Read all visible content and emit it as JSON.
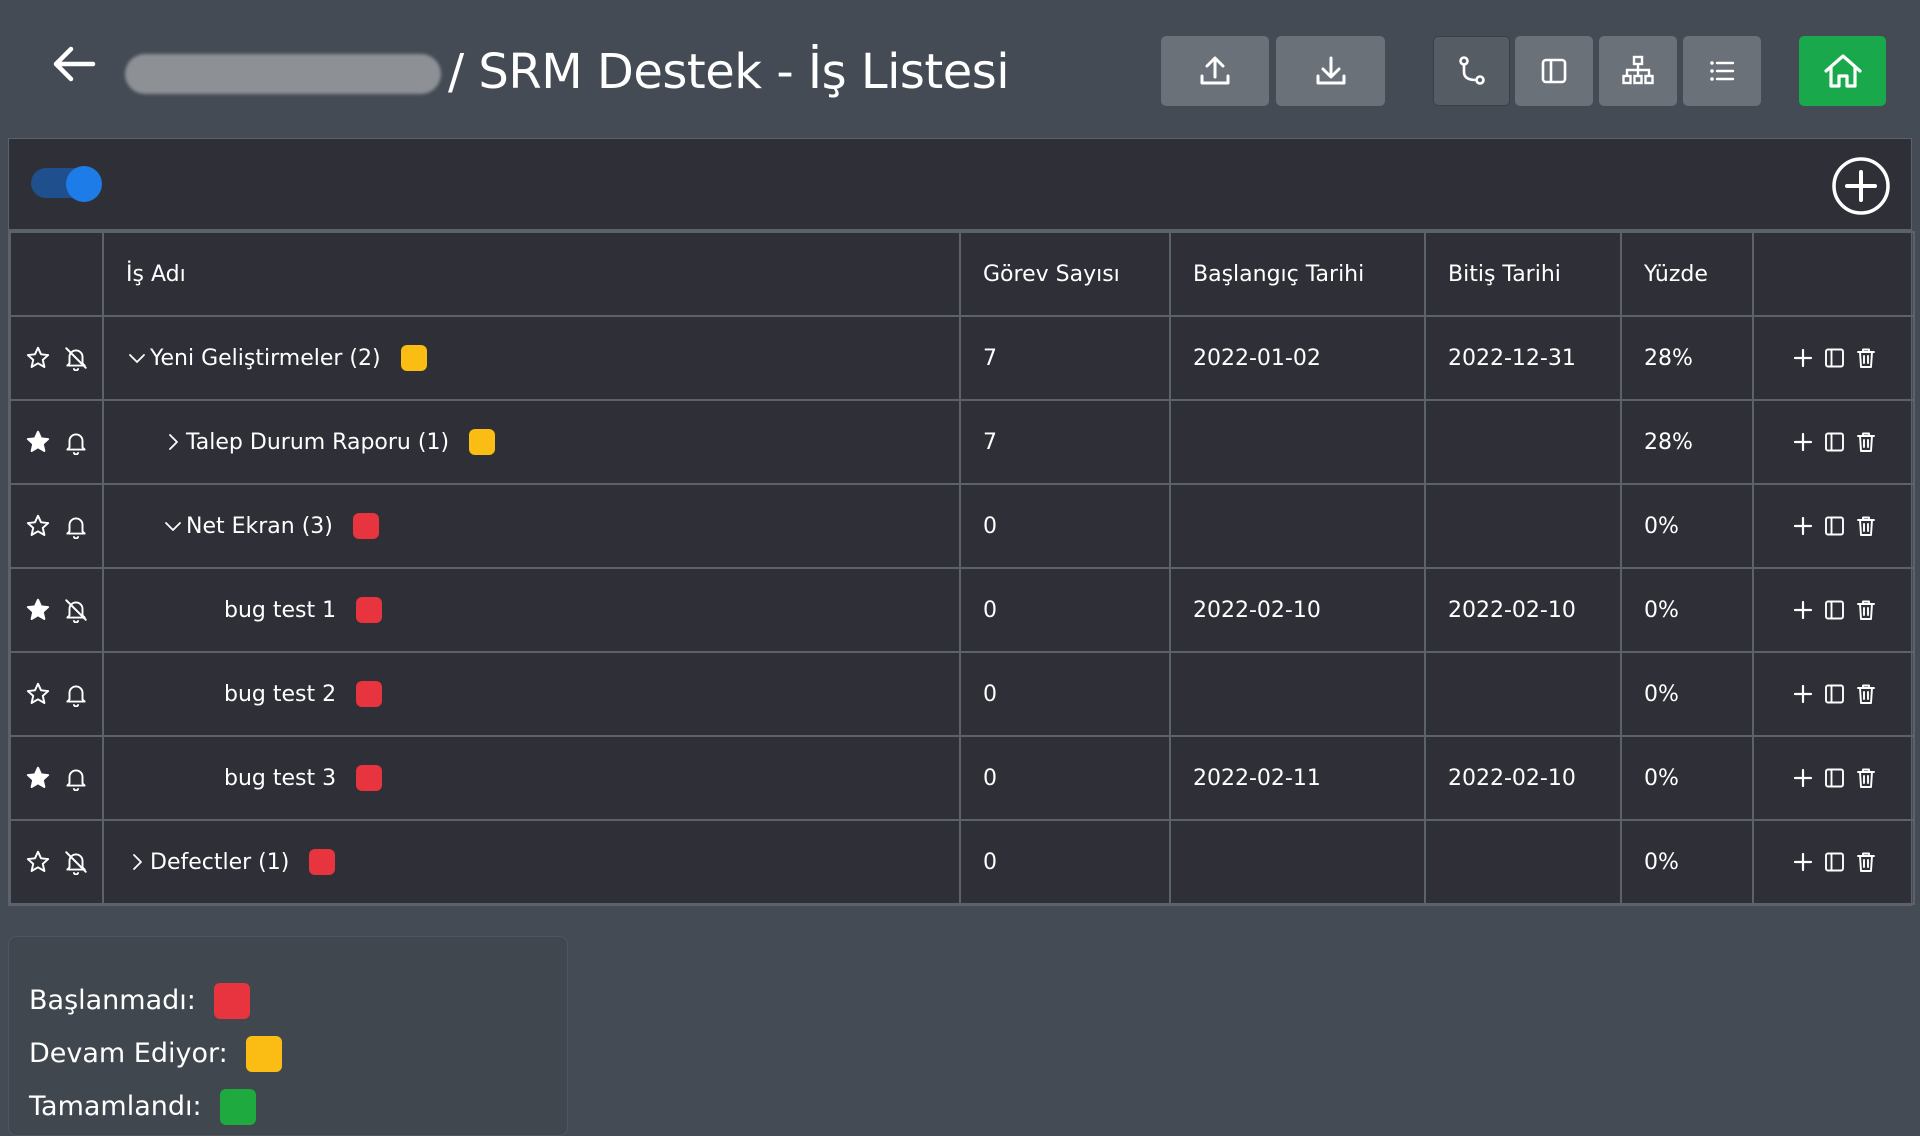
{
  "header": {
    "title": "/ SRM Destek - İş Listesi",
    "icons": [
      "arrow-left-icon",
      "upload-icon",
      "download-icon",
      "git-branch-icon",
      "sidebar-panel-icon",
      "sitemap-icon",
      "list-icon",
      "home-icon"
    ]
  },
  "colors": {
    "not_started": "#e8343e",
    "in_progress": "#fbbd13",
    "completed": "#1faa3f",
    "home_button": "#19a84b",
    "toggle": "#1d7ce8"
  },
  "table": {
    "columns": [
      "İş Adı",
      "Görev Sayısı",
      "Başlangıç Tarihi",
      "Bitiş Tarihi",
      "Yüzde"
    ],
    "rows": [
      {
        "name": "Yeni Geliştirmeler (2)",
        "level": 0,
        "chevron": "down",
        "status": "in_progress",
        "starred": false,
        "bell_off": true,
        "task_count": "7",
        "start": "2022-01-02",
        "end": "2022-12-31",
        "percent": "28%"
      },
      {
        "name": "Talep Durum Raporu (1)",
        "level": 1,
        "chevron": "right",
        "status": "in_progress",
        "starred": true,
        "bell_off": false,
        "task_count": "7",
        "start": "",
        "end": "",
        "percent": "28%"
      },
      {
        "name": "Net Ekran (3)",
        "level": 1,
        "chevron": "down",
        "status": "not_started",
        "starred": false,
        "bell_off": false,
        "task_count": "0",
        "start": "",
        "end": "",
        "percent": "0%"
      },
      {
        "name": "bug test 1",
        "level": 2,
        "chevron": "",
        "status": "not_started",
        "starred": true,
        "bell_off": true,
        "task_count": "0",
        "start": "2022-02-10",
        "end": "2022-02-10",
        "percent": "0%"
      },
      {
        "name": "bug test 2",
        "level": 2,
        "chevron": "",
        "status": "not_started",
        "starred": false,
        "bell_off": false,
        "task_count": "0",
        "start": "",
        "end": "",
        "percent": "0%"
      },
      {
        "name": "bug test 3",
        "level": 2,
        "chevron": "",
        "status": "not_started",
        "starred": true,
        "bell_off": false,
        "task_count": "0",
        "start": "2022-02-11",
        "end": "2022-02-10",
        "percent": "0%"
      },
      {
        "name": "Defectler (1)",
        "level": 0,
        "chevron": "right",
        "status": "not_started",
        "starred": false,
        "bell_off": true,
        "task_count": "0",
        "start": "",
        "end": "",
        "percent": "0%"
      }
    ]
  },
  "legend": {
    "not_started": "Başlanmadı:",
    "in_progress": "Devam Ediyor:",
    "completed": "Tamamlandı:"
  }
}
